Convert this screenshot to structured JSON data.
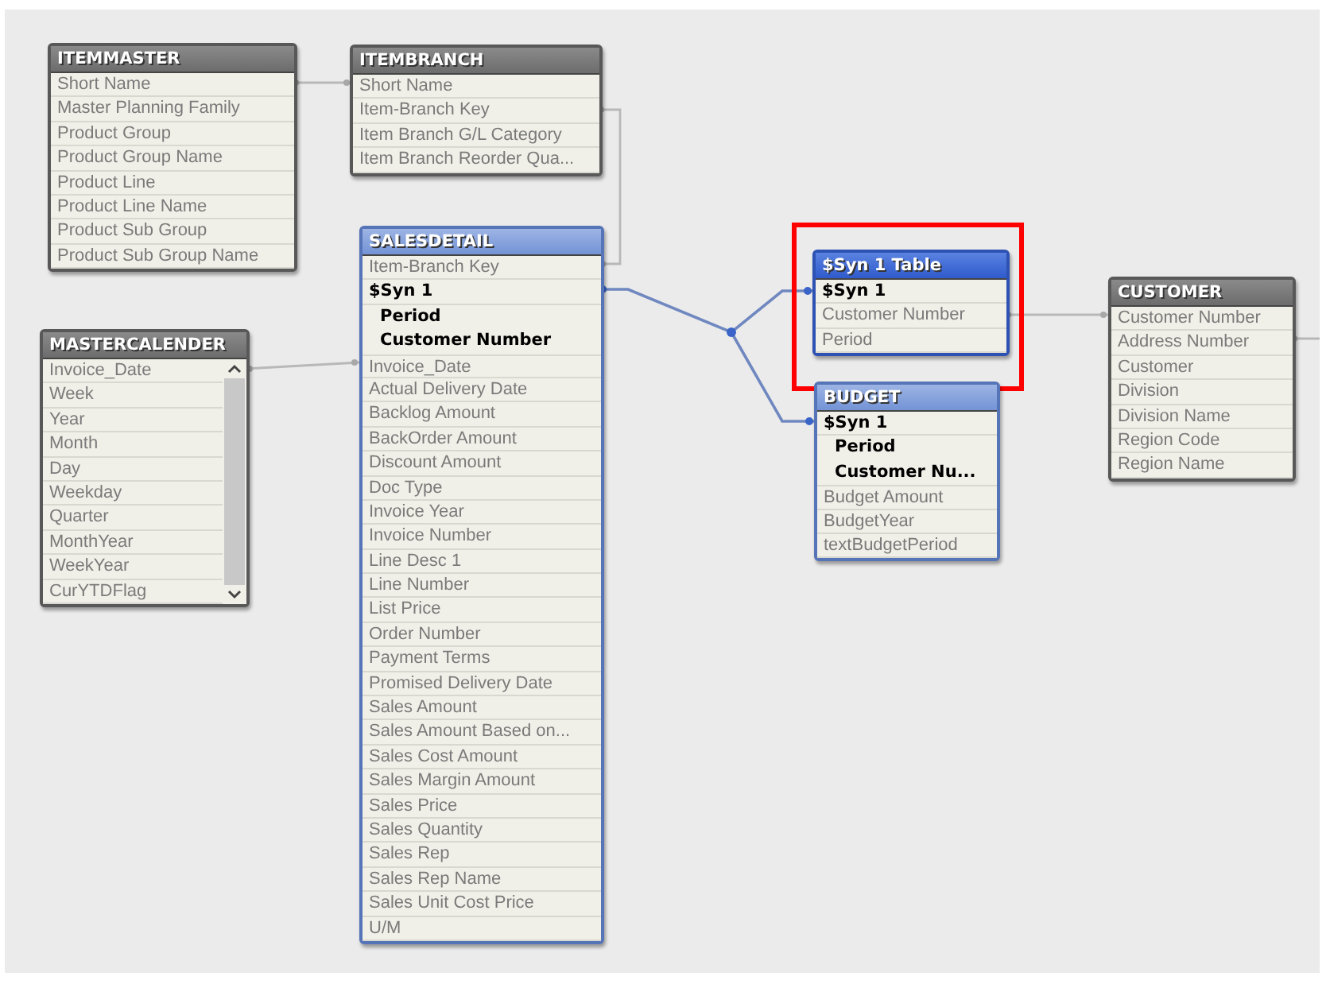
{
  "tables": [
    {
      "title": "ITEMMASTER",
      "kind": "plain",
      "fields": [
        {
          "name": "Short Name",
          "kind": "field"
        },
        {
          "name": "Master Planning Family",
          "kind": "field"
        },
        {
          "name": "Product Group",
          "kind": "field"
        },
        {
          "name": "Product Group Name",
          "kind": "field"
        },
        {
          "name": "Product Line",
          "kind": "field"
        },
        {
          "name": "Product Line Name",
          "kind": "field"
        },
        {
          "name": "Product Sub Group",
          "kind": "field"
        },
        {
          "name": "Product Sub Group Name",
          "kind": "field"
        }
      ]
    },
    {
      "title": "MASTERCALENDER",
      "kind": "plain",
      "scrollbar": true,
      "fields": [
        {
          "name": "Invoice_Date",
          "kind": "field"
        },
        {
          "name": "Week",
          "kind": "field"
        },
        {
          "name": "Year",
          "kind": "field"
        },
        {
          "name": "Month",
          "kind": "field"
        },
        {
          "name": "Day",
          "kind": "field"
        },
        {
          "name": "Weekday",
          "kind": "field"
        },
        {
          "name": "Quarter",
          "kind": "field"
        },
        {
          "name": "MonthYear",
          "kind": "field"
        },
        {
          "name": "WeekYear",
          "kind": "field"
        },
        {
          "name": "CurYTDFlag",
          "kind": "field"
        }
      ]
    },
    {
      "title": "ITEMBRANCH",
      "kind": "plain",
      "fields": [
        {
          "name": "Short Name",
          "kind": "field"
        },
        {
          "name": "Item-Branch Key",
          "kind": "field"
        },
        {
          "name": "Item Branch G/L Category",
          "kind": "field"
        },
        {
          "name": "Item Branch Reorder Qua...",
          "kind": "field"
        }
      ]
    },
    {
      "title": "SALESDETAIL",
      "kind": "linked",
      "fields": [
        {
          "name": "Item-Branch Key",
          "kind": "field"
        },
        {
          "name": "$Syn 1",
          "kind": "key"
        },
        {
          "name": "Period",
          "kind": "sub"
        },
        {
          "name": "Customer Number",
          "kind": "sub"
        },
        {
          "name": "Invoice_Date",
          "kind": "field"
        },
        {
          "name": "Actual Delivery Date",
          "kind": "field"
        },
        {
          "name": "Backlog Amount",
          "kind": "field"
        },
        {
          "name": "BackOrder Amount",
          "kind": "field"
        },
        {
          "name": "Discount Amount",
          "kind": "field"
        },
        {
          "name": "Doc Type",
          "kind": "field"
        },
        {
          "name": "Invoice Year",
          "kind": "field"
        },
        {
          "name": "Invoice Number",
          "kind": "field"
        },
        {
          "name": "Line Desc 1",
          "kind": "field"
        },
        {
          "name": "Line Number",
          "kind": "field"
        },
        {
          "name": "List Price",
          "kind": "field"
        },
        {
          "name": "Order Number",
          "kind": "field"
        },
        {
          "name": "Payment Terms",
          "kind": "field"
        },
        {
          "name": "Promised Delivery Date",
          "kind": "field"
        },
        {
          "name": "Sales Amount",
          "kind": "field"
        },
        {
          "name": "Sales Amount Based on...",
          "kind": "field"
        },
        {
          "name": "Sales Cost Amount",
          "kind": "field"
        },
        {
          "name": "Sales Margin Amount",
          "kind": "field"
        },
        {
          "name": "Sales Price",
          "kind": "field"
        },
        {
          "name": "Sales Quantity",
          "kind": "field"
        },
        {
          "name": "Sales Rep",
          "kind": "field"
        },
        {
          "name": "Sales Rep Name",
          "kind": "field"
        },
        {
          "name": "Sales Unit Cost Price",
          "kind": "field"
        },
        {
          "name": "U/M",
          "kind": "field"
        }
      ]
    },
    {
      "title": "$Syn 1 Table",
      "kind": "selected",
      "highlighted": true,
      "fields": [
        {
          "name": "$Syn 1",
          "kind": "key"
        },
        {
          "name": "Customer Number",
          "kind": "field"
        },
        {
          "name": "Period",
          "kind": "field"
        }
      ]
    },
    {
      "title": "BUDGET",
      "kind": "linked",
      "fields": [
        {
          "name": "$Syn 1",
          "kind": "key"
        },
        {
          "name": "Period",
          "kind": "sub"
        },
        {
          "name": "Customer Nu...",
          "kind": "sub"
        },
        {
          "name": "Budget Amount",
          "kind": "field"
        },
        {
          "name": "BudgetYear",
          "kind": "field"
        },
        {
          "name": "textBudgetPeriod",
          "kind": "field"
        }
      ]
    },
    {
      "title": "CUSTOMER",
      "kind": "plain",
      "fields": [
        {
          "name": "Customer Number",
          "kind": "field"
        },
        {
          "name": "Address Number",
          "kind": "field"
        },
        {
          "name": "Customer",
          "kind": "field"
        },
        {
          "name": "Division",
          "kind": "field"
        },
        {
          "name": "Division Name",
          "kind": "field"
        },
        {
          "name": "Region Code",
          "kind": "field"
        },
        {
          "name": "Region Name",
          "kind": "field"
        }
      ]
    }
  ]
}
